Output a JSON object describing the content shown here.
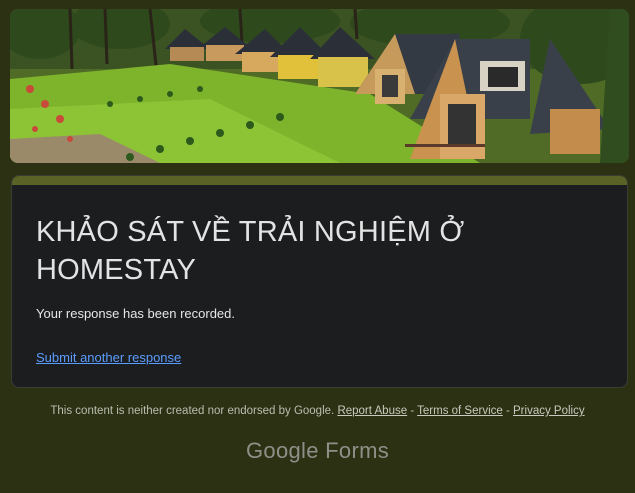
{
  "form": {
    "title": "KHẢO SÁT VỀ TRẢI NGHIỆM Ở HOMESTAY",
    "confirmation": "Your response has been recorded.",
    "submit_another": "Submit another response"
  },
  "footer": {
    "disclaimer": "This content is neither created nor endorsed by Google.",
    "report_abuse": "Report Abuse",
    "terms": "Terms of Service",
    "privacy": "Privacy Policy",
    "separator": " - "
  },
  "brand": {
    "google": "Google",
    "forms": "Forms"
  },
  "colors": {
    "background": "#2c3114",
    "card": "#1c1d1f",
    "card_accent": "#5a6226",
    "link": "#5b9dff"
  },
  "banner": {
    "icon": "homestay-photo"
  }
}
